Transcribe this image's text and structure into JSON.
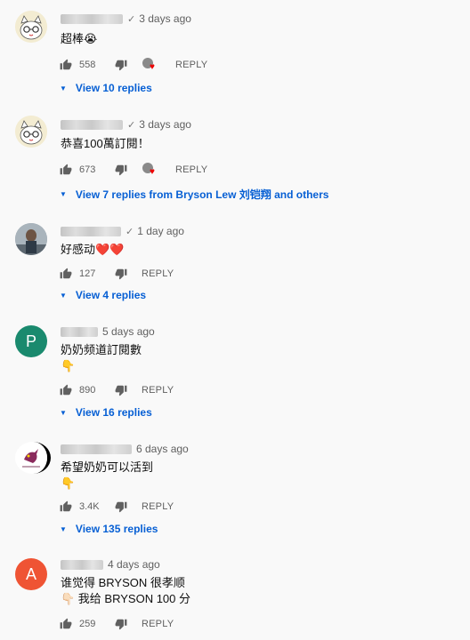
{
  "comments": [
    {
      "author": "",
      "time": "3 days ago",
      "verified": true,
      "text_lines": [
        "超棒😭"
      ],
      "likes": "558",
      "reply_label": "REPLY",
      "hearted": true,
      "replies_link": "View 10 replies",
      "avatar_letter": "",
      "avatar_color": "#f3ecd2"
    },
    {
      "author": "",
      "time": "3 days ago",
      "verified": true,
      "text_lines": [
        "恭喜100萬訂閱！"
      ],
      "likes": "673",
      "reply_label": "REPLY",
      "hearted": true,
      "replies_link": "View 7 replies from Bryson Lew 刘铠翔 and others",
      "avatar_letter": "",
      "avatar_color": "#f3ecd2"
    },
    {
      "author": "",
      "time": "1 day ago",
      "verified": true,
      "text_lines": [
        "好感动❤️❤️"
      ],
      "likes": "127",
      "reply_label": "REPLY",
      "hearted": false,
      "replies_link": "View 4 replies",
      "avatar_letter": "",
      "avatar_color": "#6b7a86"
    },
    {
      "author": "",
      "time": "5 days ago",
      "verified": false,
      "text_lines": [
        "奶奶频道訂閱數",
        "👇"
      ],
      "likes": "890",
      "reply_label": "REPLY",
      "hearted": false,
      "replies_link": "View 16 replies",
      "avatar_letter": "P",
      "avatar_color": "#1a8a6e"
    },
    {
      "author": "",
      "time": "6 days ago",
      "verified": false,
      "text_lines": [
        "希望奶奶可以活到",
        "👇"
      ],
      "likes": "3.4K",
      "reply_label": "REPLY",
      "hearted": false,
      "replies_link": "View 135 replies",
      "avatar_letter": "",
      "avatar_color": "#ffffff"
    },
    {
      "author": "",
      "time": "4 days ago",
      "verified": false,
      "text_lines": [
        "谁觉得 BRYSON 很孝顺",
        "👇🏻   我给 BRYSON 100 分"
      ],
      "likes": "259",
      "reply_label": "REPLY",
      "hearted": false,
      "replies_link": "",
      "avatar_letter": "A",
      "avatar_color": "#ef5434"
    }
  ],
  "colors": {
    "link": "#065fd4",
    "heart": "#ee0000"
  }
}
